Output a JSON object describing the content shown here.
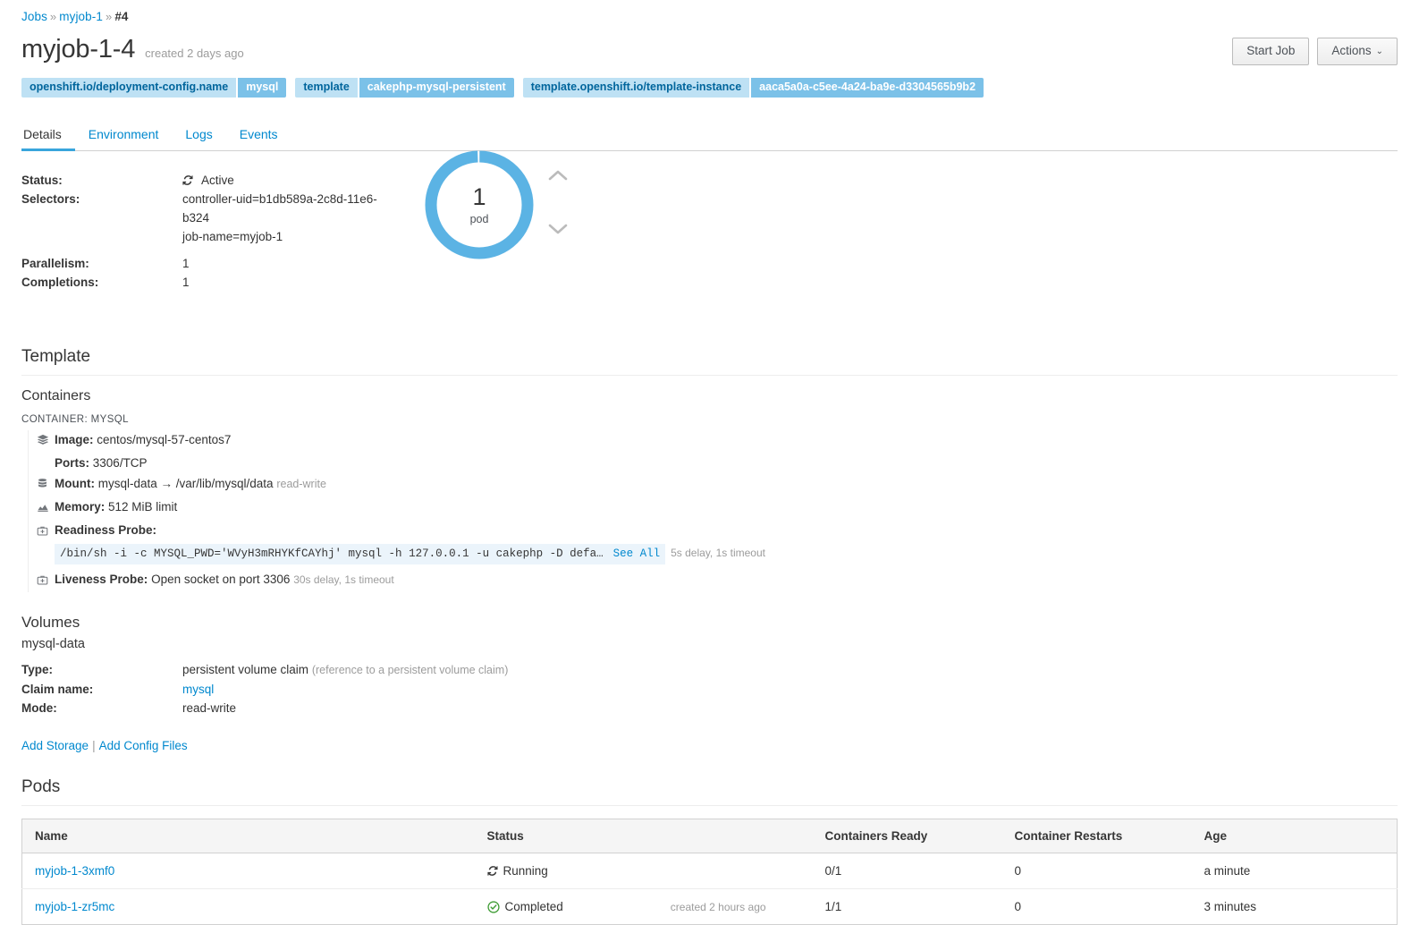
{
  "breadcrumb": {
    "root": "Jobs",
    "parent": "myjob-1",
    "current": "#4",
    "separator": "»"
  },
  "header": {
    "title": "myjob-1-4",
    "created": "created 2 days ago",
    "start_job_label": "Start Job",
    "actions_label": "Actions",
    "actions_caret": "⌄"
  },
  "labels": [
    {
      "key": "openshift.io/deployment-config.name",
      "value": "mysql"
    },
    {
      "key": "template",
      "value": "cakephp-mysql-persistent"
    },
    {
      "key": "template.openshift.io/template-instance",
      "value": "aaca5a0a-c5ee-4a24-ba9e-d3304565b9b2"
    }
  ],
  "tabs": [
    {
      "label": "Details",
      "active": true
    },
    {
      "label": "Environment",
      "active": false
    },
    {
      "label": "Logs",
      "active": false
    },
    {
      "label": "Events",
      "active": false
    }
  ],
  "details": {
    "status_key": "Status:",
    "status_value": "Active",
    "selectors_key": "Selectors:",
    "selectors_value_1": "controller-uid=b1db589a-2c8d-11e6-b324",
    "selectors_value_2": "job-name=myjob-1",
    "parallelism_key": "Parallelism:",
    "parallelism_value": "1",
    "completions_key": "Completions:",
    "completions_value": "1"
  },
  "donut": {
    "count": "1",
    "unit": "pod",
    "ring_color": "#5bb3e4",
    "track_color": "#ffffff"
  },
  "template": {
    "heading": "Template",
    "containers_heading": "Containers",
    "container_label": "CONTAINER: MYSQL",
    "image_key": "Image:",
    "image_value": "centos/mysql-57-centos7",
    "ports_key": "Ports:",
    "ports_value": "3306/TCP",
    "mount_key": "Mount:",
    "mount_value": "mysql-data → /var/lib/mysql/data",
    "mount_mode": "read-write",
    "memory_key": "Memory:",
    "memory_value": "512 MiB limit",
    "readiness_key": "Readiness Probe:",
    "readiness_cmd": "/bin/sh -i -c MYSQL_PWD='WVyH3mRHYKfCAYhj' mysql -h 127.0.0.1 -u cakephp -D defa…",
    "readiness_see_all": "See All",
    "readiness_meta": "5s delay, 1s timeout",
    "liveness_key": "Liveness Probe:",
    "liveness_value": "Open socket on port 3306",
    "liveness_meta": "30s delay, 1s timeout"
  },
  "volumes": {
    "heading": "Volumes",
    "name": "mysql-data",
    "type_key": "Type:",
    "type_value": "persistent volume claim",
    "type_note": "(reference to a persistent volume claim)",
    "claim_key": "Claim name:",
    "claim_value": "mysql",
    "mode_key": "Mode:",
    "mode_value": "read-write",
    "add_storage": "Add Storage",
    "pipe": "|",
    "add_config_files": "Add Config Files"
  },
  "pods": {
    "heading": "Pods",
    "columns": [
      "Name",
      "Status",
      "Containers Ready",
      "Container Restarts",
      "Age"
    ],
    "rows": [
      {
        "name": "myjob-1-3xmf0",
        "status": "Running",
        "status_icon": "sync-icon",
        "status_created": "",
        "containers_ready": "0/1",
        "restarts": "0",
        "age": "a minute"
      },
      {
        "name": "myjob-1-zr5mc",
        "status": "Completed",
        "status_icon": "check-circle-icon",
        "status_created": "created 2 hours ago",
        "containers_ready": "1/1",
        "restarts": "0",
        "age": "3 minutes"
      }
    ]
  },
  "colors": {
    "link": "#0088ce",
    "accent": "#39a5dc",
    "label_key_bg": "#bee1f4",
    "label_val_bg": "#7bc1e8",
    "success": "#3f9c35"
  }
}
